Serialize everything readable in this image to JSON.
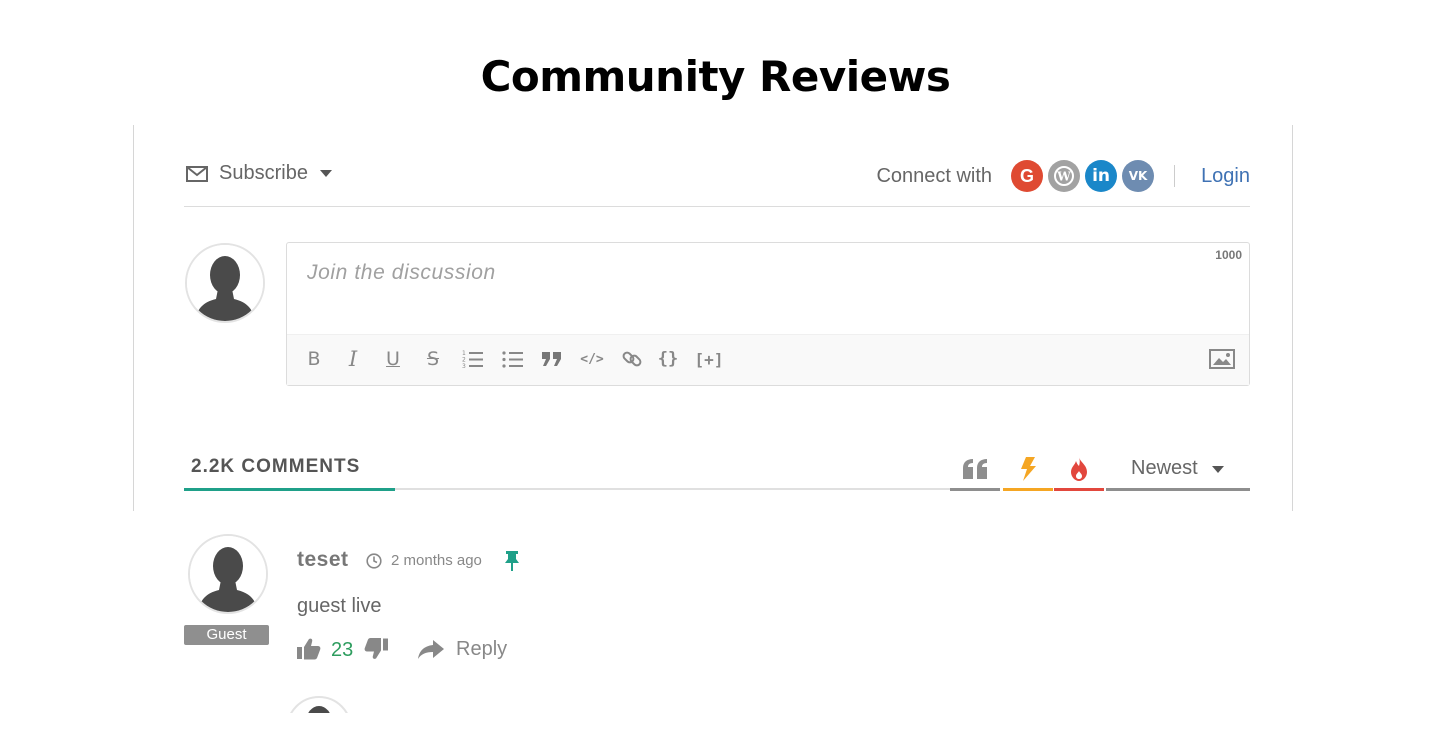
{
  "page": {
    "title": "Community Reviews"
  },
  "header": {
    "subscribe_label": "Subscribe",
    "connect_label": "Connect with",
    "social": [
      {
        "name": "google",
        "icon": "google-icon",
        "glyph": "G",
        "color": "#df4a32"
      },
      {
        "name": "wordpress",
        "icon": "wordpress-icon",
        "glyph": "W",
        "color": "#a2a2a2"
      },
      {
        "name": "linkedin",
        "icon": "linkedin-icon",
        "glyph": "in",
        "color": "#1a87c9"
      },
      {
        "name": "vk",
        "icon": "vk-icon",
        "glyph": "VK",
        "color": "#6e8cb1"
      }
    ],
    "login_label": "Login"
  },
  "editor": {
    "placeholder": "Join the discussion",
    "char_limit": "1000",
    "toolbar": [
      {
        "name": "bold-icon",
        "glyph": "B"
      },
      {
        "name": "italic-icon",
        "glyph": "I"
      },
      {
        "name": "underline-icon",
        "glyph": "U"
      },
      {
        "name": "strikethrough-icon",
        "glyph": "S"
      },
      {
        "name": "ordered-list-icon",
        "glyph": "ol"
      },
      {
        "name": "unordered-list-icon",
        "glyph": "ul"
      },
      {
        "name": "blockquote-icon",
        "glyph": "99"
      },
      {
        "name": "code-icon",
        "glyph": "</>"
      },
      {
        "name": "link-icon",
        "glyph": "link"
      },
      {
        "name": "source-code-icon",
        "glyph": "{}"
      },
      {
        "name": "spoiler-icon",
        "glyph": "[+]"
      }
    ],
    "image_icon": "image-icon"
  },
  "comments": {
    "count_label": "2.2K COMMENTS",
    "sort_options": [
      {
        "name": "most-quoted",
        "icon": "quote-icon",
        "color": "#8e8e8e"
      },
      {
        "name": "hottest",
        "icon": "bolt-icon",
        "color": "#f5a623"
      },
      {
        "name": "most-reacted",
        "icon": "fire-icon",
        "color": "#e2473d"
      }
    ],
    "sort_selected": "Newest",
    "items": [
      {
        "author": "teset",
        "badge": "Guest",
        "time": "2 months ago",
        "pinned": true,
        "text": "guest live",
        "votes": "23",
        "reply_label": "Reply"
      }
    ]
  },
  "colors": {
    "accent": "#1fa089",
    "link": "#3f72b4",
    "vote_positive": "#2e9d5f",
    "pin": "#1fa089"
  }
}
